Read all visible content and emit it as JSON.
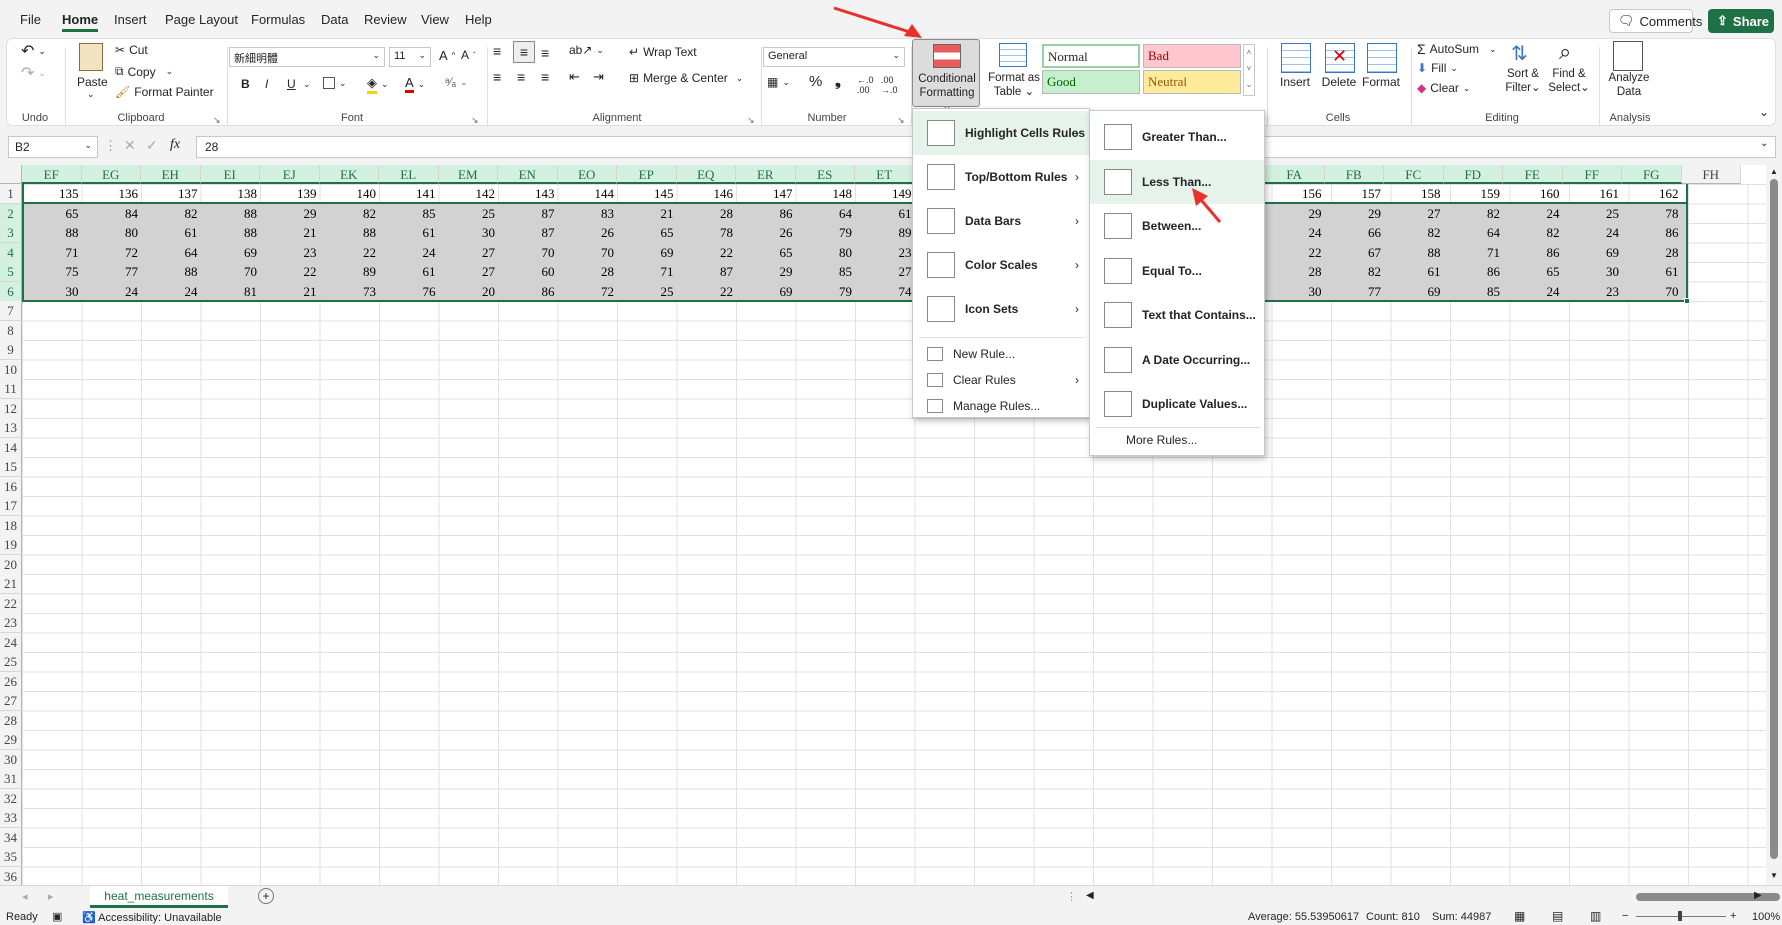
{
  "tabs": [
    "File",
    "Home",
    "Insert",
    "Page Layout",
    "Formulas",
    "Data",
    "Review",
    "View",
    "Help"
  ],
  "active_tab": "Home",
  "top_buttons": {
    "comments": "Comments",
    "share": "Share"
  },
  "ribbon": {
    "clipboard": {
      "paste": "Paste",
      "cut": "Cut",
      "copy": "Copy",
      "format_painter": "Format Painter",
      "group": "Clipboard"
    },
    "undo_group": "Undo",
    "font": {
      "name": "新細明體",
      "size": "11",
      "group": "Font",
      "bold": "B",
      "italic": "I",
      "underline": "U"
    },
    "alignment": {
      "wrap_text": "Wrap Text",
      "merge_center": "Merge & Center",
      "group": "Alignment"
    },
    "number": {
      "format": "General",
      "group": "Number"
    },
    "styles": {
      "conditional": [
        "Conditional",
        "Formatting"
      ],
      "format_table": [
        "Format as",
        "Table"
      ],
      "normal": "Normal",
      "bad": "Bad",
      "good": "Good",
      "neutral": "Neutral"
    },
    "cells": {
      "insert": "Insert",
      "delete": "Delete",
      "format": "Format",
      "group": "Cells"
    },
    "editing": {
      "autosum": "AutoSum",
      "fill": "Fill",
      "clear": "Clear",
      "sort": [
        "Sort &",
        "Filter"
      ],
      "find": [
        "Find &",
        "Select"
      ],
      "group": "Editing"
    },
    "analysis": {
      "analyze": [
        "Analyze",
        "Data"
      ],
      "group": "Analysis"
    }
  },
  "formula_bar": {
    "name_box": "B2",
    "fx": "fx",
    "value": "28"
  },
  "columns_left": [
    "EF",
    "EG",
    "EH",
    "EI",
    "EJ",
    "EK",
    "EL",
    "EM",
    "EN",
    "EO",
    "EP",
    "EQ",
    "ER",
    "ES",
    "ET"
  ],
  "columns_right": [
    "FA",
    "FB",
    "FC",
    "FD",
    "FE",
    "FF",
    "FG",
    "FH"
  ],
  "row_numbers": [
    "1",
    "2",
    "3",
    "4",
    "5",
    "6",
    "7",
    "8",
    "9",
    "10",
    "11",
    "12",
    "13",
    "14",
    "15",
    "16",
    "17",
    "18",
    "19",
    "20",
    "21",
    "22",
    "23",
    "24",
    "25",
    "26",
    "27",
    "28",
    "29",
    "30",
    "31",
    "32",
    "33",
    "34",
    "35",
    "36"
  ],
  "data_left": [
    [
      "135",
      "136",
      "137",
      "138",
      "139",
      "140",
      "141",
      "142",
      "143",
      "144",
      "145",
      "146",
      "147",
      "148",
      "149"
    ],
    [
      "65",
      "84",
      "82",
      "88",
      "29",
      "82",
      "85",
      "25",
      "87",
      "83",
      "21",
      "28",
      "86",
      "64",
      "61"
    ],
    [
      "88",
      "80",
      "61",
      "88",
      "21",
      "88",
      "61",
      "30",
      "87",
      "26",
      "65",
      "78",
      "26",
      "79",
      "89"
    ],
    [
      "71",
      "72",
      "64",
      "69",
      "23",
      "22",
      "24",
      "27",
      "70",
      "70",
      "69",
      "22",
      "65",
      "80",
      "23"
    ],
    [
      "75",
      "77",
      "88",
      "70",
      "22",
      "89",
      "61",
      "27",
      "60",
      "28",
      "71",
      "87",
      "29",
      "85",
      "27"
    ],
    [
      "30",
      "24",
      "24",
      "81",
      "21",
      "73",
      "76",
      "20",
      "86",
      "72",
      "25",
      "22",
      "69",
      "79",
      "74"
    ]
  ],
  "data_right": [
    [
      "5",
      "156",
      "157",
      "158",
      "159",
      "160",
      "161",
      "162"
    ],
    [
      "3",
      "29",
      "29",
      "27",
      "82",
      "24",
      "25",
      "78"
    ],
    [
      "4",
      "24",
      "66",
      "82",
      "64",
      "82",
      "24",
      "86"
    ],
    [
      "",
      "22",
      "67",
      "88",
      "71",
      "86",
      "69",
      "28"
    ],
    [
      "4",
      "28",
      "82",
      "61",
      "86",
      "65",
      "30",
      "61"
    ],
    [
      "7",
      "30",
      "77",
      "69",
      "85",
      "24",
      "23",
      "70"
    ]
  ],
  "cf_menu": [
    {
      "label": "Highlight Cells Rules",
      "icon": "highlight-cells-icon",
      "submenu": true
    },
    {
      "label": "Top/Bottom Rules",
      "icon": "top-bottom-icon",
      "submenu": true
    },
    {
      "label": "Data Bars",
      "icon": "data-bars-icon",
      "submenu": true
    },
    {
      "label": "Color Scales",
      "icon": "color-scales-icon",
      "submenu": true
    },
    {
      "label": "Icon Sets",
      "icon": "icon-sets-icon",
      "submenu": true
    }
  ],
  "cf_small": [
    {
      "label": "New Rule...",
      "submenu": false
    },
    {
      "label": "Clear Rules",
      "submenu": true
    },
    {
      "label": "Manage Rules...",
      "submenu": false
    }
  ],
  "hcr_menu": [
    "Greater Than...",
    "Less Than...",
    "Between...",
    "Equal To...",
    "Text that Contains...",
    "A Date Occurring...",
    "Duplicate Values..."
  ],
  "hcr_more": "More Rules...",
  "sheet_tab": "heat_measurements",
  "status": {
    "ready": "Ready",
    "accessibility": "Accessibility: Unavailable",
    "average": "Average: 55.53950617",
    "count": "Count: 810",
    "sum": "Sum: 44987",
    "zoom": "100%"
  },
  "colors": {
    "accent": "#1e7145",
    "selection": "#d2d2d2",
    "annotation_arrow": "#e8302c"
  }
}
